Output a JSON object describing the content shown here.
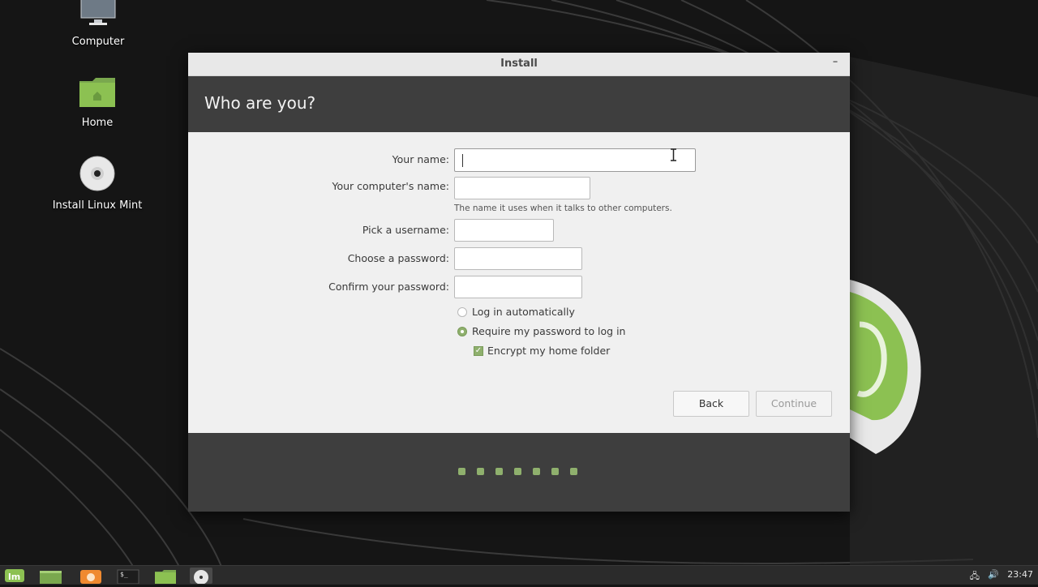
{
  "desktop": {
    "icons": [
      {
        "label": "Computer",
        "icon": "computer-icon"
      },
      {
        "label": "Home",
        "icon": "home-folder-icon"
      },
      {
        "label": "Install Linux Mint",
        "icon": "disc-icon"
      }
    ]
  },
  "window": {
    "title": "Install",
    "minimize_label": "–",
    "heading": "Who are you?",
    "fields": {
      "your_name": {
        "label": "Your name:",
        "value": ""
      },
      "computer_name": {
        "label": "Your computer's name:",
        "value": "",
        "hint": "The name it uses when it talks to other computers."
      },
      "username": {
        "label": "Pick a username:",
        "value": ""
      },
      "password": {
        "label": "Choose a password:",
        "value": ""
      },
      "confirm_password": {
        "label": "Confirm your password:",
        "value": ""
      }
    },
    "options": {
      "log_in_automatically": {
        "label": "Log in automatically",
        "selected": false
      },
      "require_password": {
        "label": "Require my password to log in",
        "selected": true
      },
      "encrypt_home": {
        "label": "Encrypt my home folder",
        "checked": true
      }
    },
    "buttons": {
      "back": "Back",
      "continue": "Continue"
    },
    "progress": {
      "total_steps": 7,
      "accent": "#8fb06d"
    }
  },
  "taskbar": {
    "items": [
      "mint-menu-icon",
      "show-desktop-icon",
      "firefox-icon",
      "terminal-icon",
      "files-icon",
      "installer-icon"
    ],
    "clock": "23:47"
  },
  "colors": {
    "accent": "#8fb06d",
    "header": "#3e3e3e"
  }
}
